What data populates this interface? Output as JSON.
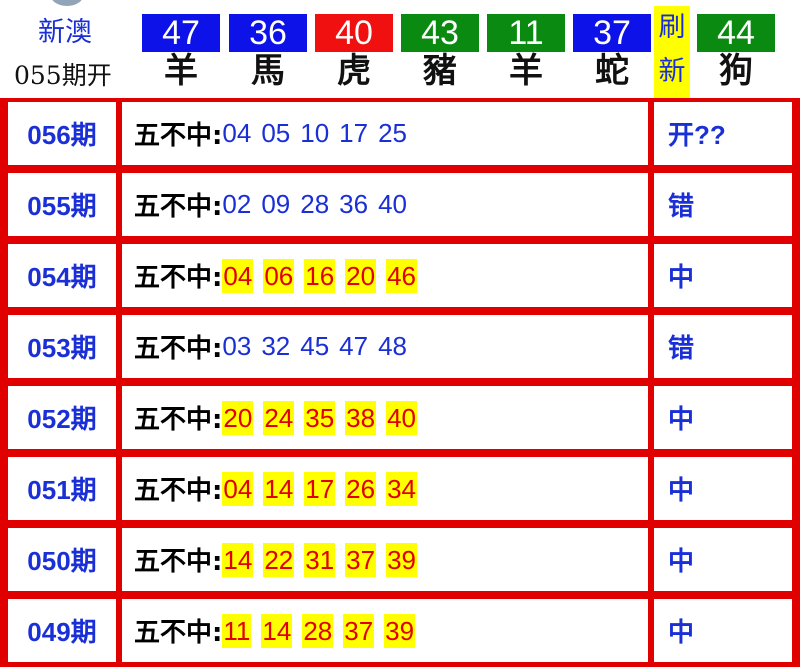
{
  "header": {
    "title": "新澳",
    "subtitle": "055期开",
    "balls": [
      {
        "number": "47",
        "zodiac": "羊",
        "color": "#0c12e8"
      },
      {
        "number": "36",
        "zodiac": "馬",
        "color": "#0c12e8"
      },
      {
        "number": "40",
        "zodiac": "虎",
        "color": "#f01010"
      },
      {
        "number": "43",
        "zodiac": "豬",
        "color": "#0a8a10"
      },
      {
        "number": "11",
        "zodiac": "羊",
        "color": "#0a8a10"
      },
      {
        "number": "37",
        "zodiac": "蛇",
        "color": "#0c12e8"
      }
    ],
    "refresh_label": "刷新",
    "special": {
      "number": "44",
      "zodiac": "狗",
      "color": "#0a8a10"
    }
  },
  "table": {
    "label": "五不中:",
    "rows": [
      {
        "period": "056期",
        "numbers": [
          "04",
          "05",
          "10",
          "17",
          "25"
        ],
        "highlight": false,
        "result": "开??"
      },
      {
        "period": "055期",
        "numbers": [
          "02",
          "09",
          "28",
          "36",
          "40"
        ],
        "highlight": false,
        "result": "错"
      },
      {
        "period": "054期",
        "numbers": [
          "04",
          "06",
          "16",
          "20",
          "46"
        ],
        "highlight": true,
        "result": "中"
      },
      {
        "period": "053期",
        "numbers": [
          "03",
          "32",
          "45",
          "47",
          "48"
        ],
        "highlight": false,
        "result": "错"
      },
      {
        "period": "052期",
        "numbers": [
          "20",
          "24",
          "35",
          "38",
          "40"
        ],
        "highlight": true,
        "result": "中"
      },
      {
        "period": "051期",
        "numbers": [
          "04",
          "14",
          "17",
          "26",
          "34"
        ],
        "highlight": true,
        "result": "中"
      },
      {
        "period": "050期",
        "numbers": [
          "14",
          "22",
          "31",
          "37",
          "39"
        ],
        "highlight": true,
        "result": "中"
      },
      {
        "period": "049期",
        "numbers": [
          "11",
          "14",
          "28",
          "37",
          "39"
        ],
        "highlight": true,
        "result": "中"
      }
    ]
  }
}
